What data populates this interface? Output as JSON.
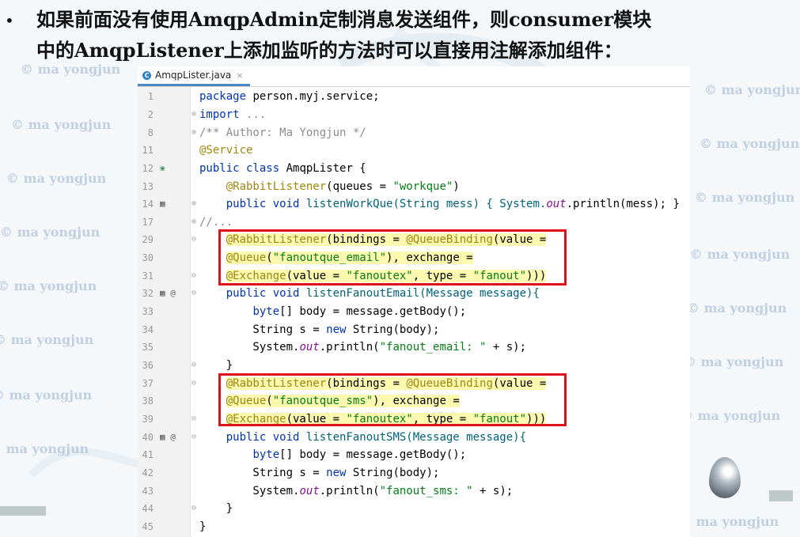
{
  "heading": {
    "line1": "如果前面没有使用AmqpAdmin定制消息发送组件，则consumer模块",
    "line2": "中的AmqpListener上添加监听的方法时可以直接用注解添加组件："
  },
  "watermark_text": "© ma yongjun",
  "tab": {
    "label": "AmqpLister.java",
    "close": "×",
    "icon": "C"
  },
  "lines": {
    "l1": {
      "n": "1"
    },
    "l2": {
      "n": "2",
      "a": "import",
      "b": " ..."
    },
    "l8": {
      "n": "8",
      "a": "/** Author: Ma Yongjun */"
    },
    "l11": {
      "n": "11",
      "a": "@Service"
    },
    "l12": {
      "n": "12",
      "a": "public class",
      "b": " AmqpLister {"
    },
    "l13": {
      "n": "13",
      "a": "    ",
      "b": "@RabbitListener",
      "c": "(queues = ",
      "d": "\"workque\"",
      "e": ")"
    },
    "l14": {
      "n": "14",
      "a": "    public void",
      "b": " listenWorkQue(String mess) { System.",
      "c": "out",
      "d": ".println(mess); }"
    },
    "l17": {
      "n": "17",
      "a": "//..."
    },
    "l29": {
      "n": "29",
      "a": "    ",
      "b": "@RabbitListener",
      "c": "(bindings = ",
      "d": "@QueueBinding",
      "e": "(value ="
    },
    "l30": {
      "n": "30",
      "a": "    ",
      "b": "@Queue",
      "c": "(",
      "d": "\"fanoutque_email\"",
      "e": "), exchange ="
    },
    "l31": {
      "n": "31",
      "a": "    ",
      "b": "@Exchange",
      "c": "(value = ",
      "d": "\"fanoutex\"",
      "e": ", type = ",
      "f": "\"fanout\"",
      "g": ")))"
    },
    "l32": {
      "n": "32",
      "a": "    public void",
      "b": " listenFanoutEmail(Message message){"
    },
    "l33": {
      "n": "33",
      "a": "        ",
      "b": "byte",
      "c": "[] body = message.getBody();"
    },
    "l34": {
      "n": "34",
      "a": "        String s = ",
      "b": "new",
      "c": " String(body);"
    },
    "l35": {
      "n": "35",
      "a": "        System.",
      "b": "out",
      "c": ".println(",
      "d": "\"fanout_email: \"",
      "e": " + s);"
    },
    "l36": {
      "n": "36",
      "a": "    }"
    },
    "l37": {
      "n": "37",
      "a": "    ",
      "b": "@RabbitListener",
      "c": "(bindings = ",
      "d": "@QueueBinding",
      "e": "(value ="
    },
    "l38": {
      "n": "38",
      "a": "    ",
      "b": "@Queue",
      "c": "(",
      "d": "\"fanoutque_sms\"",
      "e": "), exchange ="
    },
    "l39": {
      "n": "39",
      "a": "    ",
      "b": "@Exchange",
      "c": "(value = ",
      "d": "\"fanoutex\"",
      "e": ", type = ",
      "f": "\"fanout\"",
      "g": ")))"
    },
    "l40": {
      "n": "40",
      "a": "    public void",
      "b": " listenFanoutSMS(Message message){"
    },
    "l41": {
      "n": "41",
      "a": "        ",
      "b": "byte",
      "c": "[] body = message.getBody();"
    },
    "l42": {
      "n": "42",
      "a": "        String s = ",
      "b": "new",
      "c": " String(body);"
    },
    "l43": {
      "n": "43",
      "a": "        System.",
      "b": "out",
      "c": ".println(",
      "d": "\"fanout_sms: \"",
      "e": " + s);"
    },
    "l44": {
      "n": "44",
      "a": "    }"
    },
    "l45": {
      "n": "45",
      "a": "}"
    }
  },
  "line1_code": {
    "kw": "package",
    "rest": " person.myj.service;"
  },
  "colors": {
    "keyword": "#0033b3",
    "string": "#067d17",
    "annotation": "#9e880d",
    "highlight_box": "#e0101a",
    "tab_underline": "#4a88c7"
  },
  "gutter_icons": {
    "class_marker": "spring-bean-icon",
    "method_marker": "run-method-icon",
    "annotation_marker": "@"
  }
}
